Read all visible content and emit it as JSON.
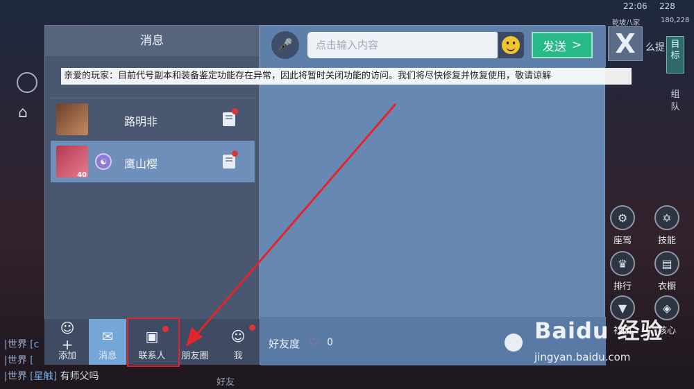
{
  "hud": {
    "time": "22:06",
    "battery": "228",
    "player_name": "乾坡八家",
    "coins": "180,228",
    "target_label": "目标",
    "team_label": "组队",
    "side_text": "么提",
    "bottom_friend": "好友"
  },
  "side_buttons": [
    {
      "label": "座驾",
      "icon": "⚙"
    },
    {
      "label": "技能",
      "icon": "✡"
    },
    {
      "label": "排行",
      "icon": "♛"
    },
    {
      "label": "衣橱",
      "icon": "▤"
    },
    {
      "label": "社团",
      "icon": "▼"
    },
    {
      "label": "核心",
      "icon": "◈"
    }
  ],
  "chat_log": [
    {
      "channel": "|世界",
      "name": "[c",
      "text": ""
    },
    {
      "channel": "|世界",
      "name": "[",
      "text": ""
    },
    {
      "channel": "|世界",
      "name": "[星触]",
      "text": "有师父吗"
    }
  ],
  "left_panel": {
    "title": "消息",
    "contacts": [
      {
        "name": "路明非",
        "level": "",
        "avatar_color": "#8a5a3c"
      },
      {
        "name": "鹰山樱",
        "level": "40",
        "avatar_color": "#c2485e"
      }
    ]
  },
  "notice": "亲爱的玩家：目前代号副本和装备鉴定功能存在异常，因此将暂时关闭功能的访问。我们将尽快修复并恢复使用，敬请谅解",
  "bottom_tabs": [
    {
      "label": "添加",
      "icon": "☺+"
    },
    {
      "label": "消息",
      "icon": "✉"
    },
    {
      "label": "联系人",
      "icon": "▣"
    },
    {
      "label": "朋友圈",
      "icon": "✢"
    },
    {
      "label": "我",
      "icon": "☺"
    }
  ],
  "chat": {
    "input_placeholder": "点击输入内容",
    "send_label": "发送",
    "send_arrow": ">"
  },
  "friendship": {
    "label": "好友度",
    "value": "0"
  },
  "close_glyph": "X",
  "watermark": {
    "main": "Baidu 经验",
    "url": "jingyan.baidu.com"
  },
  "colors": {
    "accent": "#27b98a",
    "highlight": "#e2242c",
    "selected_tab": "#74a6d8"
  }
}
